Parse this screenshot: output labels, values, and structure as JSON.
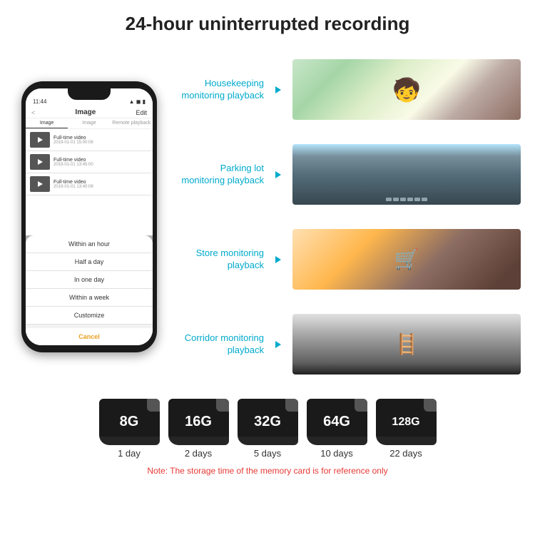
{
  "header": {
    "title": "24-hour uninterrupted recording"
  },
  "phone": {
    "status_time": "11:44",
    "nav_back": "<",
    "nav_title": "Image",
    "nav_edit": "Edit",
    "tabs": [
      "Image",
      "Image",
      "Remote playback"
    ],
    "list_items": [
      {
        "title": "Full-time video",
        "date": "2019-01-01 15:00:08"
      },
      {
        "title": "Full-time video",
        "date": "2019-01-01 13:45:00"
      },
      {
        "title": "Full-time video",
        "date": "2019-01-01 13:40:08"
      }
    ],
    "popup_items": [
      "Within an hour",
      "Half a day",
      "In one day",
      "Within a week",
      "Customize"
    ],
    "popup_cancel": "Cancel"
  },
  "scenarios": [
    {
      "label": "Housekeeping\nmonitoring playback",
      "type": "housekeeping"
    },
    {
      "label": "Parking lot\nmonitoring playback",
      "type": "parking"
    },
    {
      "label": "Store monitoring\nplayback",
      "type": "store"
    },
    {
      "label": "Corridor monitoring\nplayback",
      "type": "corridor"
    }
  ],
  "sd_cards": [
    {
      "size": "8G",
      "days": "1 day"
    },
    {
      "size": "16G",
      "days": "2 days"
    },
    {
      "size": "32G",
      "days": "5 days"
    },
    {
      "size": "64G",
      "days": "10 days"
    },
    {
      "size": "128G",
      "days": "22 days"
    }
  ],
  "note": "Note: The storage time of the memory card is for reference only",
  "colors": {
    "accent": "#00aacc",
    "note_red": "#e53935",
    "phone_bg": "#1a1a1a",
    "popup_cancel": "#e8a020"
  }
}
